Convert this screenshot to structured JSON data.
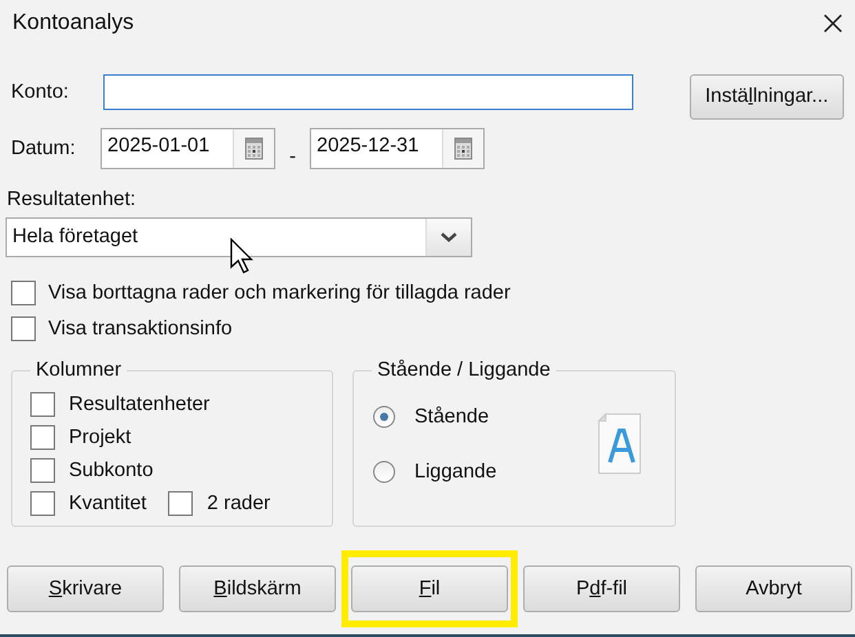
{
  "window": {
    "title": "Kontoanalys"
  },
  "konto": {
    "label": "Konto:",
    "focused": true
  },
  "settings_button": {
    "before": "Instä",
    "key": "l",
    "after": "lningar..."
  },
  "datum": {
    "label": "Datum:",
    "from": "2025-01-01",
    "separator": "-",
    "to": "2025-12-31"
  },
  "resultatenhet": {
    "label": "Resultatenhet:",
    "value": "Hela företaget"
  },
  "options": [
    {
      "label": "Visa borttagna rader och markering för tillagda rader",
      "checked": false
    },
    {
      "label": "Visa transaktionsinfo",
      "checked": false
    }
  ],
  "kolumner": {
    "title": "Kolumner",
    "items": [
      {
        "label": "Resultatenheter",
        "checked": false
      },
      {
        "label": "Projekt",
        "checked": false
      },
      {
        "label": "Subkonto",
        "checked": false
      },
      {
        "label": "Kvantitet",
        "checked": false
      },
      {
        "label": "2 rader",
        "checked": false
      }
    ]
  },
  "orientation": {
    "title": "Stående / Liggande",
    "items": [
      {
        "label": "Stående",
        "selected": true
      },
      {
        "label": "Liggande",
        "selected": false
      }
    ]
  },
  "buttons": [
    {
      "key": "S",
      "after": "krivare",
      "highlighted": false
    },
    {
      "key": "B",
      "after": "ildskärm",
      "highlighted": false
    },
    {
      "key": "F",
      "after": "il",
      "highlighted": true
    },
    {
      "before": "P",
      "key": "d",
      "after": "f-fil",
      "highlighted": false
    },
    {
      "before": "Avbryt",
      "highlighted": false
    }
  ]
}
